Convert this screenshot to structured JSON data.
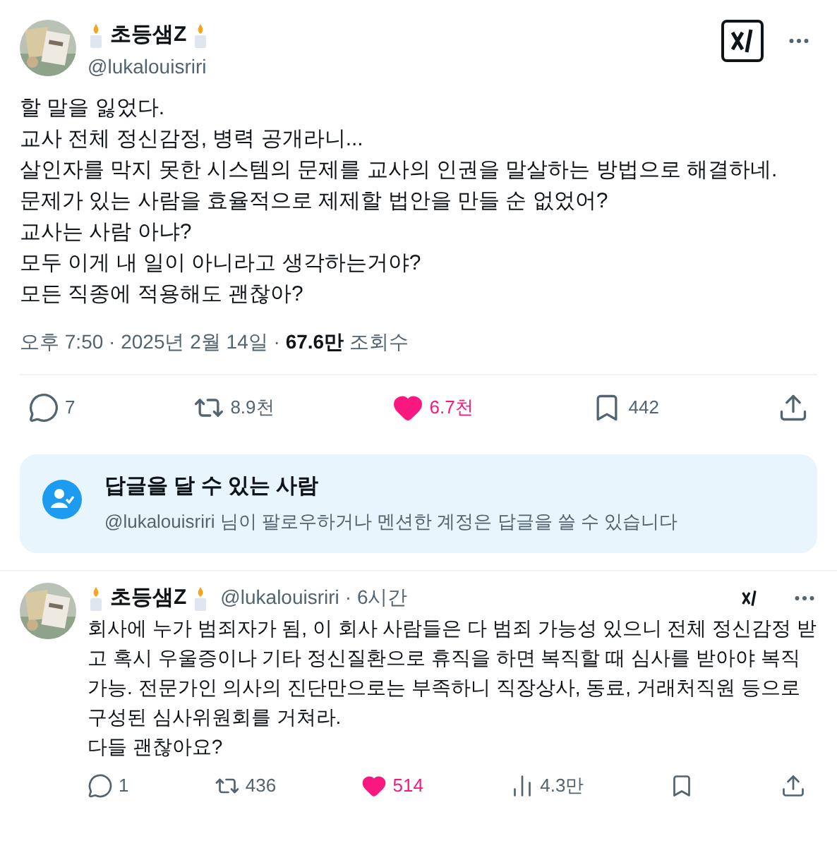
{
  "post": {
    "name": "초등샘Z",
    "handle": "@lukalouisriri",
    "lines": [
      "할 말을 잃었다.",
      "교사 전체 정신감정, 병력 공개라니...",
      "살인자를 막지 못한 시스템의 문제를 교사의 인권을 말살하는 방법으로 해결하네.",
      "문제가 있는 사람을 효율적으로 제제할 법안을 만들 순 없었어?",
      "교사는 사람 아냐?",
      "모두 이게 내 일이 아니라고 생각하는거야?",
      "모든 직종에 적용해도 괜찮아?"
    ],
    "time": "오후 7:50 · 2025년 2월 14일 · ",
    "views": "67.6만",
    "views_label": " 조회수",
    "actions": [
      {
        "kind": "reply",
        "count": "7"
      },
      {
        "kind": "repost",
        "count": "8.9천"
      },
      {
        "kind": "like",
        "count": "6.7천",
        "liked": true
      },
      {
        "kind": "bookmark",
        "count": "442"
      },
      {
        "kind": "share"
      }
    ]
  },
  "reply_notice": {
    "title": "답글을 달 수 있는 사람",
    "text": "@lukalouisriri 님이 팔로우하거나 멘션한 계정은 답글을 쓸 수 있습니다"
  },
  "reply": {
    "name": "초등샘Z",
    "handle": "@lukalouisriri",
    "time": "· 6시간",
    "lines": [
      "회사에 누가 범죄자가 됨, 이 회사 사람들은 다 범죄 가능성 있으니 전체 정신감정 받고 혹시 우울증이나 기타 정신질환으로 휴직을 하면 복직할 때 심사를 받아야 복직 가능. 전문가인 의사의 진단만으로는 부족하니 직장상사, 동료, 거래처직원 등으로 구성된 심사위원회를 거쳐라.",
      "다들 괜찮아요?"
    ],
    "actions": [
      {
        "kind": "reply",
        "count": "1"
      },
      {
        "kind": "repost",
        "count": "436"
      },
      {
        "kind": "like",
        "count": "514",
        "liked": true
      },
      {
        "kind": "views",
        "count": "4.3만"
      },
      {
        "kind": "bookmark"
      },
      {
        "kind": "share"
      }
    ]
  }
}
